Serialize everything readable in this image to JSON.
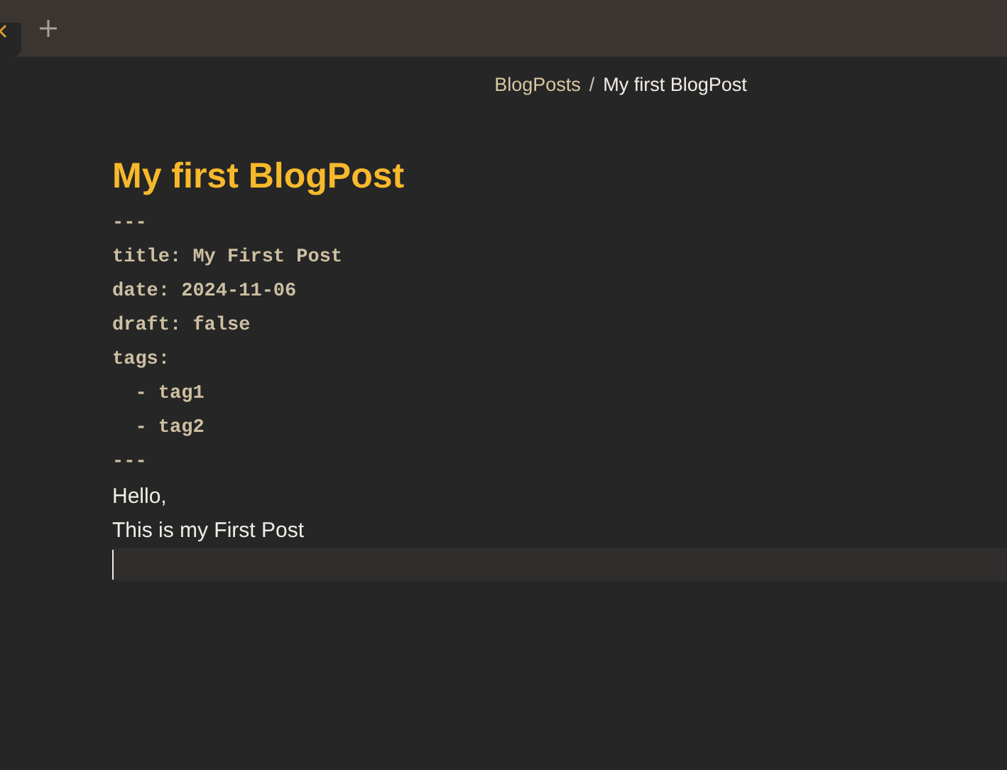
{
  "breadcrumb": {
    "items": [
      "BlogPosts",
      "My first BlogPost"
    ],
    "separator": "/"
  },
  "note": {
    "title": "My first BlogPost",
    "frontmatter": [
      "---",
      "title: My First Post",
      "date: 2024-11-06",
      "draft: false",
      "tags:",
      "  - tag1",
      "  - tag2",
      "---"
    ],
    "body": [
      "Hello,",
      "This is my First Post"
    ]
  }
}
